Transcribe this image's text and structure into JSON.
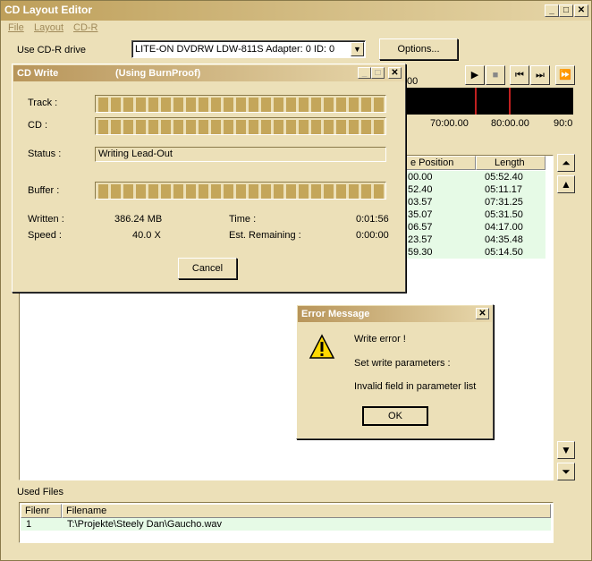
{
  "window": {
    "title": "CD Layout Editor",
    "min": "_",
    "max": "□",
    "close": "✕"
  },
  "menu": [
    "File",
    "Layout",
    "CD-R"
  ],
  "drive": {
    "label": "Use CD-R drive",
    "value": "LITE-ON DVDRW LDW-811S   Adapter: 0  ID: 0",
    "options_label": "Options..."
  },
  "timeline": {
    "ticks": [
      "70:00.00",
      "80:00.00",
      "90:0"
    ],
    "partial_time": "00"
  },
  "media_buttons": {
    "play": "▶",
    "stop": "■",
    "prev": "⏮",
    "next": "⏭",
    "ff": "⏩"
  },
  "track_table": {
    "headers": [
      "e Position",
      "Length"
    ],
    "rows": [
      [
        "00.00",
        "05:52.40"
      ],
      [
        "52.40",
        "05:11.17"
      ],
      [
        "03.57",
        "07:31.25"
      ],
      [
        "35.07",
        "05:31.50"
      ],
      [
        "06.57",
        "04:17.00"
      ],
      [
        "23.57",
        "04:35.48"
      ],
      [
        "59.30",
        "05:14.50"
      ]
    ]
  },
  "move_buttons": {
    "top": "⏶",
    "up": "▲",
    "down": "▼",
    "bottom": "⏷"
  },
  "used_files": {
    "label": "Used Files",
    "headers": [
      "Filenr",
      "Filename"
    ],
    "rows": [
      [
        "1",
        "T:\\Projekte\\Steely Dan\\Gaucho.wav"
      ]
    ]
  },
  "cd_write": {
    "title": "CD Write",
    "subtitle": "(Using BurnProof)",
    "track_label": "Track :",
    "cd_label": "CD :",
    "status_label": "Status :",
    "status_value": "Writing Lead-Out",
    "buffer_label": "Buffer :",
    "written_label": "Written :",
    "written_value": "386.24 MB",
    "speed_label": "Speed :",
    "speed_value": "40.0 X",
    "time_label": "Time :",
    "time_value": "0:01:56",
    "remaining_label": "Est. Remaining :",
    "remaining_value": "0:00:00",
    "cancel_label": "Cancel",
    "track_progress": 1.0,
    "cd_progress": 1.0,
    "buffer_progress": 1.0
  },
  "error": {
    "title": "Error Message",
    "icon": "warning-icon",
    "line1": "Write error !",
    "line2": "Set write parameters :",
    "line3": "Invalid field in parameter list",
    "ok_label": "OK"
  }
}
